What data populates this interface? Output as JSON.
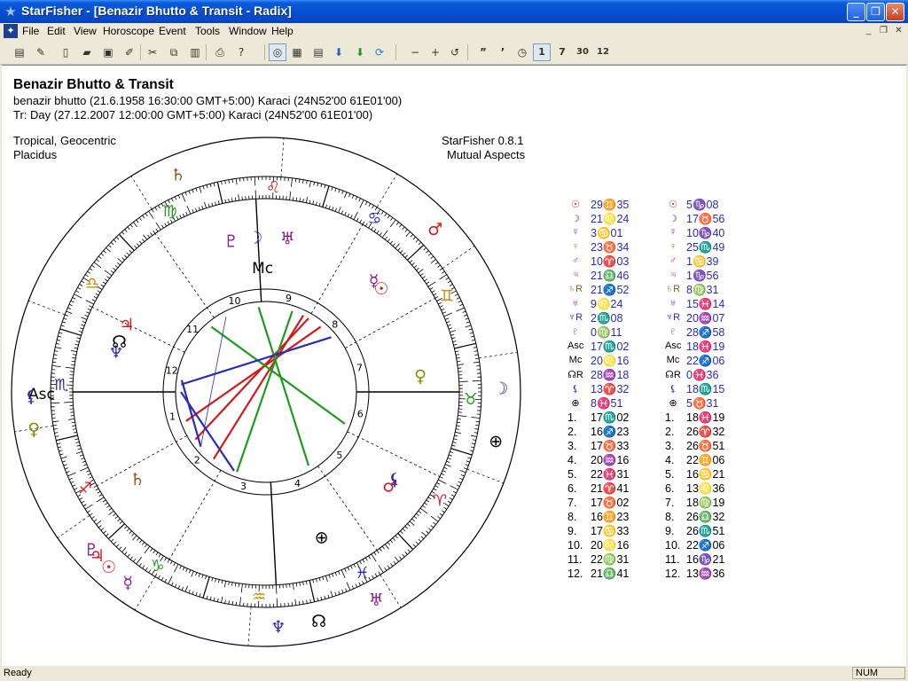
{
  "window": {
    "title": "StarFisher - [Benazir Bhutto & Transit - Radix]"
  },
  "menu": [
    "File",
    "Edit",
    "View",
    "Horoscope",
    "Event",
    "Tools",
    "Window",
    "Help"
  ],
  "header": {
    "title": "Benazir Bhutto & Transit",
    "line1": "benazir bhutto (21.6.1958 16:30:00 GMT+5:00) Karaci  (24N52'00 61E01'00)",
    "line2": "Tr: Day (27.12.2007 12:00:00 GMT+5:00) Karaci  (24N52'00 61E01'00)",
    "system1": "Tropical, Geocentric",
    "system2": "Placidus",
    "app": "StarFisher 0.8.1",
    "mode": "Mutual Aspects"
  },
  "colors": {
    "blue": "#2b2bb5",
    "red": "#d21a1a",
    "green": "#1f9a1f",
    "black": "#000000"
  },
  "positions": [
    {
      "sym": "☉",
      "c": "#d21a1a",
      "natal": "29♊35",
      "transit": "5♑08"
    },
    {
      "sym": "☽",
      "c": "#2b2bb5",
      "natal": "21♌24",
      "transit": "17♉56"
    },
    {
      "sym": "☿",
      "c": "#8a1a8a",
      "natal": "3♋01",
      "transit": "10♑40"
    },
    {
      "sym": "♀",
      "c": "#8a8a00",
      "natal": "23♉34",
      "transit": "25♏49"
    },
    {
      "sym": "♂",
      "c": "#d21a1a",
      "natal": "10♈03",
      "transit": "1♋39"
    },
    {
      "sym": "♃",
      "c": "#d21a1a",
      "natal": "21♎46",
      "transit": "1♑56"
    },
    {
      "sym": "♄R",
      "c": "#8a5a1a",
      "natal": "21♐52",
      "transit": "8♍31"
    },
    {
      "sym": "♅",
      "c": "#8a1a8a",
      "natal": "9♌24",
      "transit": "15♓14"
    },
    {
      "sym": "♆R",
      "c": "#2b2bb5",
      "natal": "2♏08",
      "transit": "20♒07"
    },
    {
      "sym": "♇",
      "c": "#8a1a8a",
      "natal": "0♍11",
      "transit": "28♐58"
    },
    {
      "sym": "Asc",
      "c": "#000000",
      "natal": "17♏02",
      "transit": "18♓19"
    },
    {
      "sym": "Mc",
      "c": "#000000",
      "natal": "20♌16",
      "transit": "22♐06"
    },
    {
      "sym": "☊R",
      "c": "#000000",
      "natal": "28♒18",
      "transit": "0♓36"
    },
    {
      "sym": "⚸",
      "c": "#2b2bb5",
      "natal": "13♈32",
      "transit": "18♏15"
    },
    {
      "sym": "⊕",
      "c": "#000000",
      "natal": "8♓51",
      "transit": "5♉31"
    }
  ],
  "houses": [
    {
      "n": "1.",
      "natal": "17♏02",
      "transit": "18♓19"
    },
    {
      "n": "2.",
      "natal": "16♐23",
      "transit": "26♈32"
    },
    {
      "n": "3.",
      "natal": "17♉33",
      "transit": "26♉51"
    },
    {
      "n": "4.",
      "natal": "20♒16",
      "transit": "22♊06"
    },
    {
      "n": "5.",
      "natal": "22♓31",
      "transit": "16♋21"
    },
    {
      "n": "6.",
      "natal": "21♈41",
      "transit": "13♌36"
    },
    {
      "n": "7.",
      "natal": "17♉02",
      "transit": "18♍19"
    },
    {
      "n": "8.",
      "natal": "16♊23",
      "transit": "26♎32"
    },
    {
      "n": "9.",
      "natal": "17♋33",
      "transit": "26♏51"
    },
    {
      "n": "10.",
      "natal": "20♌16",
      "transit": "22♐06"
    },
    {
      "n": "11.",
      "natal": "22♍31",
      "transit": "16♑21"
    },
    {
      "n": "12.",
      "natal": "21♎41",
      "transit": "13♒36"
    }
  ],
  "wheel": {
    "mc_label": "Mc",
    "asc_label": "Asc",
    "house_numbers": [
      "1",
      "2",
      "3",
      "4",
      "5",
      "6",
      "7",
      "8",
      "9",
      "10",
      "11",
      "12"
    ],
    "sign_glyphs": [
      "♈",
      "♉",
      "♊",
      "♋",
      "♌",
      "♍",
      "♎",
      "♏",
      "♐",
      "♑",
      "♒",
      "♓"
    ]
  },
  "status": {
    "ready": "Ready",
    "num": "NUM"
  }
}
